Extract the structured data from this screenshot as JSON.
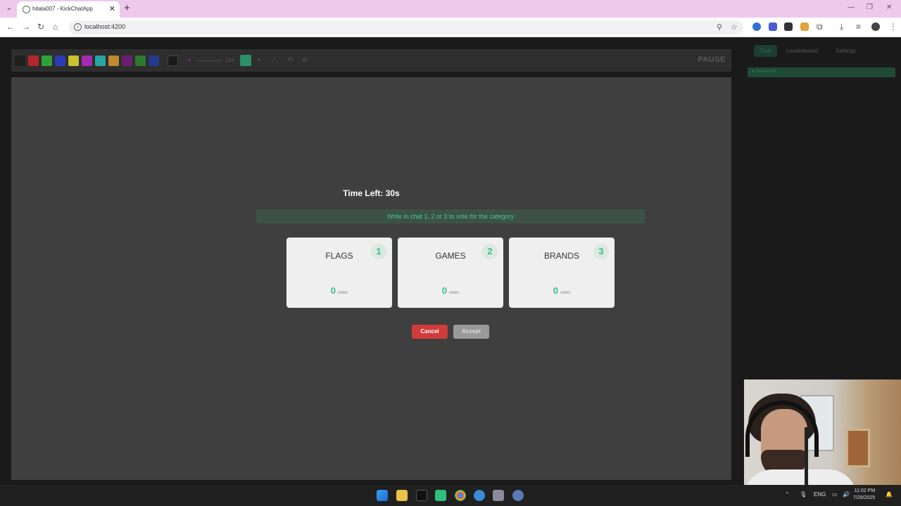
{
  "browser": {
    "tab_title": "hitala007 - KickChatApp",
    "tab_close": "✕",
    "new_tab": "+",
    "url": "localhost:4200",
    "win_min": "—",
    "win_max": "❐",
    "win_close": "✕"
  },
  "toolbar": {
    "colors": [
      "#1f1f1f",
      "#b3262b",
      "#2ea33b",
      "#2a3bb5",
      "#c9c22e",
      "#a52ab3",
      "#27a5a5",
      "#c08a2a",
      "#6a1f6e",
      "#2e7a2e",
      "#243a8a"
    ],
    "current_color": "#1a1a1a",
    "brush_size": "1px",
    "fill_color": "#2a8f68",
    "pause_label": "PAUSE"
  },
  "side_panel": {
    "tabs": [
      "Chat",
      "Leaderboard",
      "Settings"
    ],
    "active_tab": "Chat",
    "connection_status": "● Connected"
  },
  "vote": {
    "timer": "Time Left: 30s",
    "hint": "Write in chat 1, 2 or 3 to vote for the category",
    "categories": [
      {
        "name": "FLAGS",
        "number": "1",
        "votes": "0",
        "votes_label": "votes"
      },
      {
        "name": "GAMES",
        "number": "2",
        "votes": "0",
        "votes_label": "votes"
      },
      {
        "name": "BRANDS",
        "number": "3",
        "votes": "0",
        "votes_label": "votes"
      }
    ],
    "cancel_label": "Cancel",
    "accept_label": "Accept"
  },
  "taskbar": {
    "lang": "ENG",
    "time": "11:02 PM",
    "date": "7/29/2025"
  },
  "accent_color": "#3bbf88",
  "danger_color": "#d13b3b"
}
